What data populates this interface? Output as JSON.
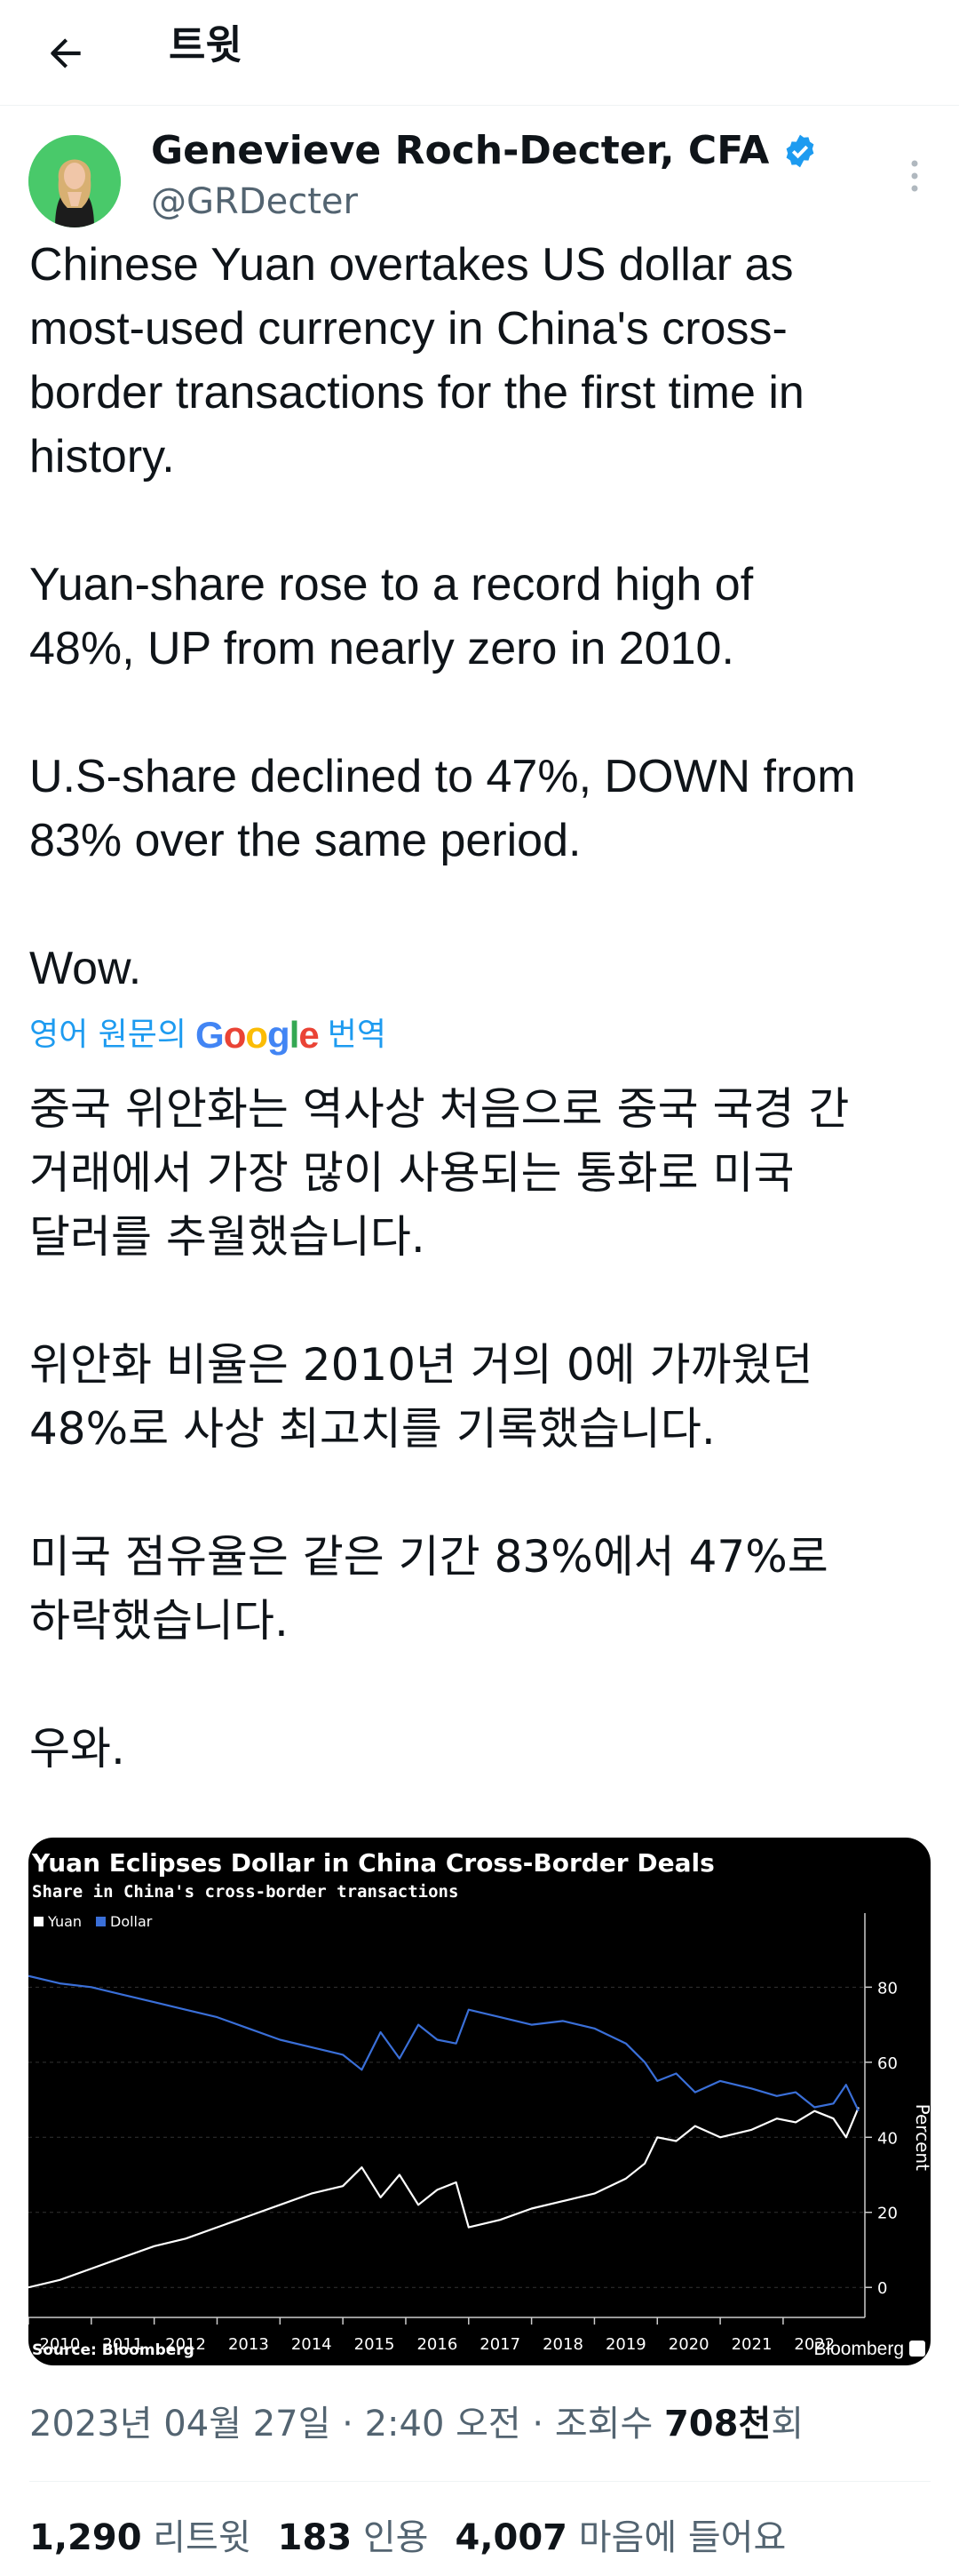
{
  "header": {
    "title": "트윗"
  },
  "author": {
    "name": "Genevieve Roch-Decter, CFA",
    "handle": "@GRDecter"
  },
  "tweet": {
    "text_en": "Chinese Yuan overtakes US dollar as\nmost-used currency in China's cross-\nborder transactions for the first time in\nhistory.\n\nYuan-share rose to a record high of\n48%, UP from nearly zero in 2010.\n\nU.S-share declined to 47%, DOWN from\n83% over the same period.\n\nWow.",
    "translate_prefix": "영어 원문의",
    "translate_brand": "Google",
    "translate_suffix": "번역",
    "text_ko": "중국 위안화는 역사상 처음으로 중국 국경 간\n거래에서 가장 많이 사용되는 통화로 미국\n달러를 추월했습니다.\n\n위안화 비율은 2010년 거의 0에 가까웠던\n48%로 사상 최고치를 기록했습니다.\n\n미국 점유율은 같은 기간 83%에서 47%로\n하락했습니다.\n\n우와."
  },
  "chart_data": {
    "type": "line",
    "title": "Yuan Eclipses Dollar in China Cross-Border Deals",
    "subtitle": "Share in China's cross-border transactions",
    "ylabel": "Percent",
    "source": "Source: Bloomberg",
    "brand": "Bloomberg",
    "ylim": [
      -8,
      95
    ],
    "yticks": [
      0,
      20,
      40,
      60,
      80
    ],
    "x_range": [
      2010.0,
      2023.3
    ],
    "x_tick_labels": [
      "2010",
      "2011",
      "2012",
      "2013",
      "2014",
      "2015",
      "2016",
      "2017",
      "2018",
      "2019",
      "2020",
      "2021",
      "2022"
    ],
    "legend_placement": "top-left",
    "series": [
      {
        "name": "Yuan",
        "color": "#ffffff",
        "x": [
          2010.0,
          2010.5,
          2011.0,
          2011.5,
          2012.0,
          2012.5,
          2013.0,
          2013.5,
          2014.0,
          2014.5,
          2015.0,
          2015.3,
          2015.6,
          2015.9,
          2016.2,
          2016.5,
          2016.8,
          2017.0,
          2017.5,
          2018.0,
          2018.5,
          2019.0,
          2019.5,
          2019.8,
          2020.0,
          2020.3,
          2020.6,
          2021.0,
          2021.5,
          2021.9,
          2022.2,
          2022.5,
          2022.8,
          2023.0,
          2023.2
        ],
        "y": [
          0,
          2,
          5,
          8,
          11,
          13,
          16,
          19,
          22,
          25,
          27,
          32,
          24,
          30,
          22,
          26,
          28,
          16,
          18,
          21,
          23,
          25,
          29,
          33,
          40,
          39,
          43,
          40,
          42,
          45,
          44,
          47,
          45,
          40,
          48
        ]
      },
      {
        "name": "Dollar",
        "color": "#3a6fd8",
        "x": [
          2010.0,
          2010.5,
          2011.0,
          2011.5,
          2012.0,
          2012.5,
          2013.0,
          2013.5,
          2014.0,
          2014.5,
          2015.0,
          2015.3,
          2015.6,
          2015.9,
          2016.2,
          2016.5,
          2016.8,
          2017.0,
          2017.5,
          2018.0,
          2018.5,
          2019.0,
          2019.5,
          2019.8,
          2020.0,
          2020.3,
          2020.6,
          2021.0,
          2021.5,
          2021.9,
          2022.2,
          2022.5,
          2022.8,
          2023.0,
          2023.2
        ],
        "y": [
          83,
          81,
          80,
          78,
          76,
          74,
          72,
          69,
          66,
          64,
          62,
          58,
          68,
          61,
          70,
          66,
          65,
          74,
          72,
          70,
          71,
          69,
          65,
          60,
          55,
          57,
          52,
          55,
          53,
          51,
          52,
          48,
          49,
          54,
          47
        ]
      }
    ]
  },
  "meta": {
    "datetime": "2023년 04월 27일 · 2:40 오전 · 조회수 ",
    "views": "708천",
    "views_suffix": "회"
  },
  "stats": {
    "retweets": "1,290",
    "retweets_label": "리트윗",
    "quotes": "183",
    "quotes_label": "인용",
    "likes": "4,007",
    "likes_label": "마음에 들어요"
  },
  "icons": [
    "arrow-left-icon",
    "verified-badge-icon",
    "more-vertical-icon"
  ],
  "colors": {
    "accent": "#1d9bf0",
    "secondary_text": "#536471",
    "avatar_bg": "#49c96a"
  }
}
